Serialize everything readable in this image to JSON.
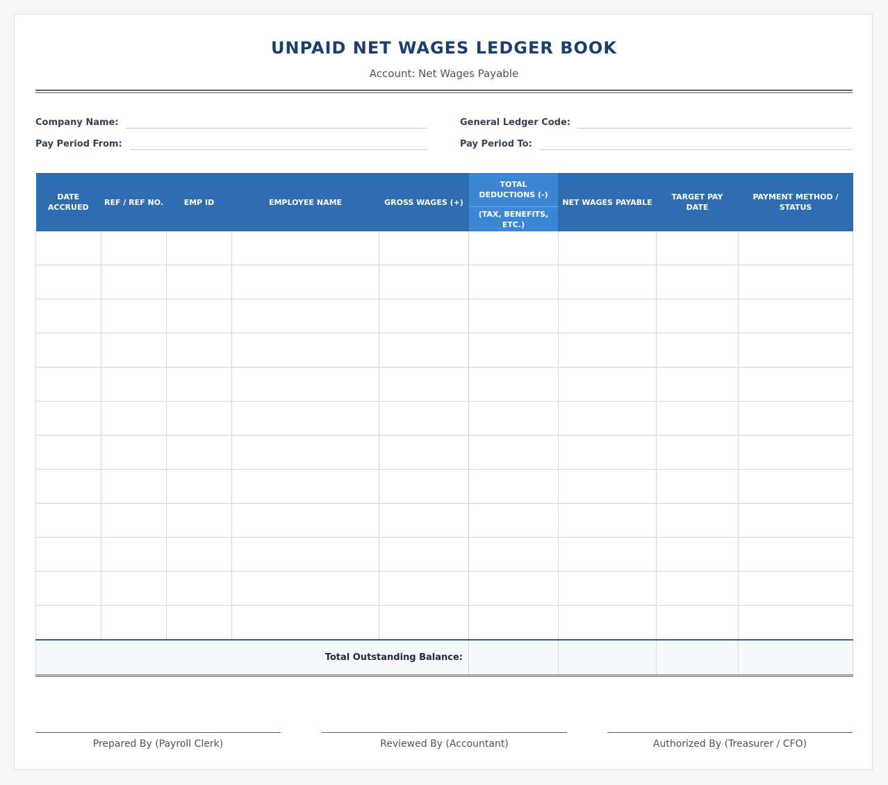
{
  "title": "UNPAID NET WAGES LEDGER BOOK",
  "subtitle": "Account: Net Wages Payable",
  "fields": {
    "company_name": "Company Name:",
    "general_ledger_code": "General Ledger Code:",
    "pay_period_from": "Pay Period From:",
    "pay_period_to": "Pay Period To:"
  },
  "table": {
    "headers": {
      "date_accrued": "DATE ACCRUED",
      "ref_no": "REF / REF NO.",
      "emp_id": "EMP ID",
      "employee_name": "EMPLOYEE NAME",
      "gross_wages": "GROSS WAGES (+)",
      "total_deductions": "TOTAL DEDUCTIONS (-)",
      "total_deductions_sub": "(TAX, BENEFITS, ETC.)",
      "net_wages_payable": "NET WAGES PAYABLE",
      "target_pay_date": "TARGET PAY DATE",
      "payment_method": "PAYMENT METHOD / STATUS"
    },
    "blank_rows": 12,
    "total_label": "Total Outstanding Balance:"
  },
  "signatures": {
    "prepared_by": "Prepared By (Payroll Clerk)",
    "reviewed_by": "Reviewed By (Accountant)",
    "authorized_by": "Authorized By (Treasurer / CFO)"
  },
  "colors": {
    "header_blue": "#2f6db1",
    "deductions_blue": "#3c86d3",
    "title_navy": "#1d3f6e"
  }
}
